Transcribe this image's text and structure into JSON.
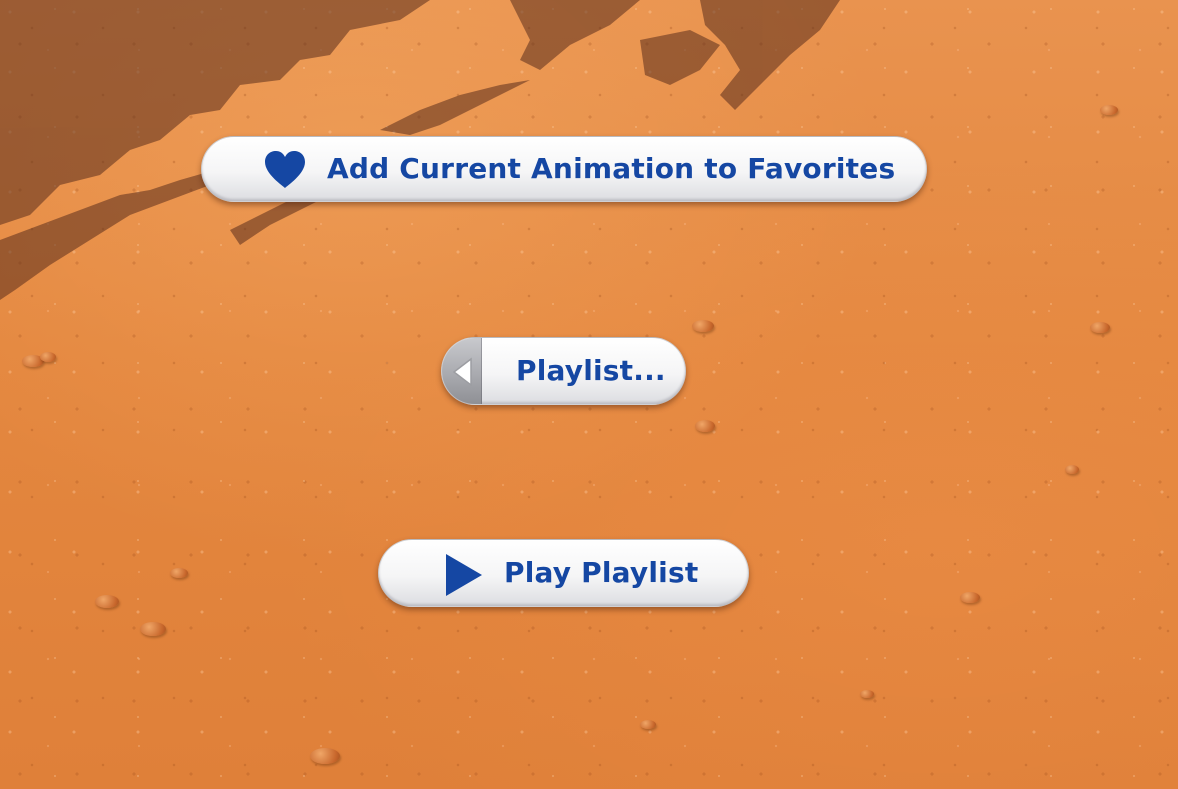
{
  "buttons": {
    "favorites": {
      "label": "Add Current Animation to Favorites",
      "icon": "heart-icon"
    },
    "playlist": {
      "label": "Playlist...",
      "icon": "arrow-left-icon"
    },
    "play_playlist": {
      "label": "Play Playlist",
      "icon": "play-icon"
    }
  },
  "colors": {
    "button_text": "#1547a3",
    "icon": "#1547a3",
    "button_face": "#f5f5f6",
    "ground": "#e4873f"
  }
}
